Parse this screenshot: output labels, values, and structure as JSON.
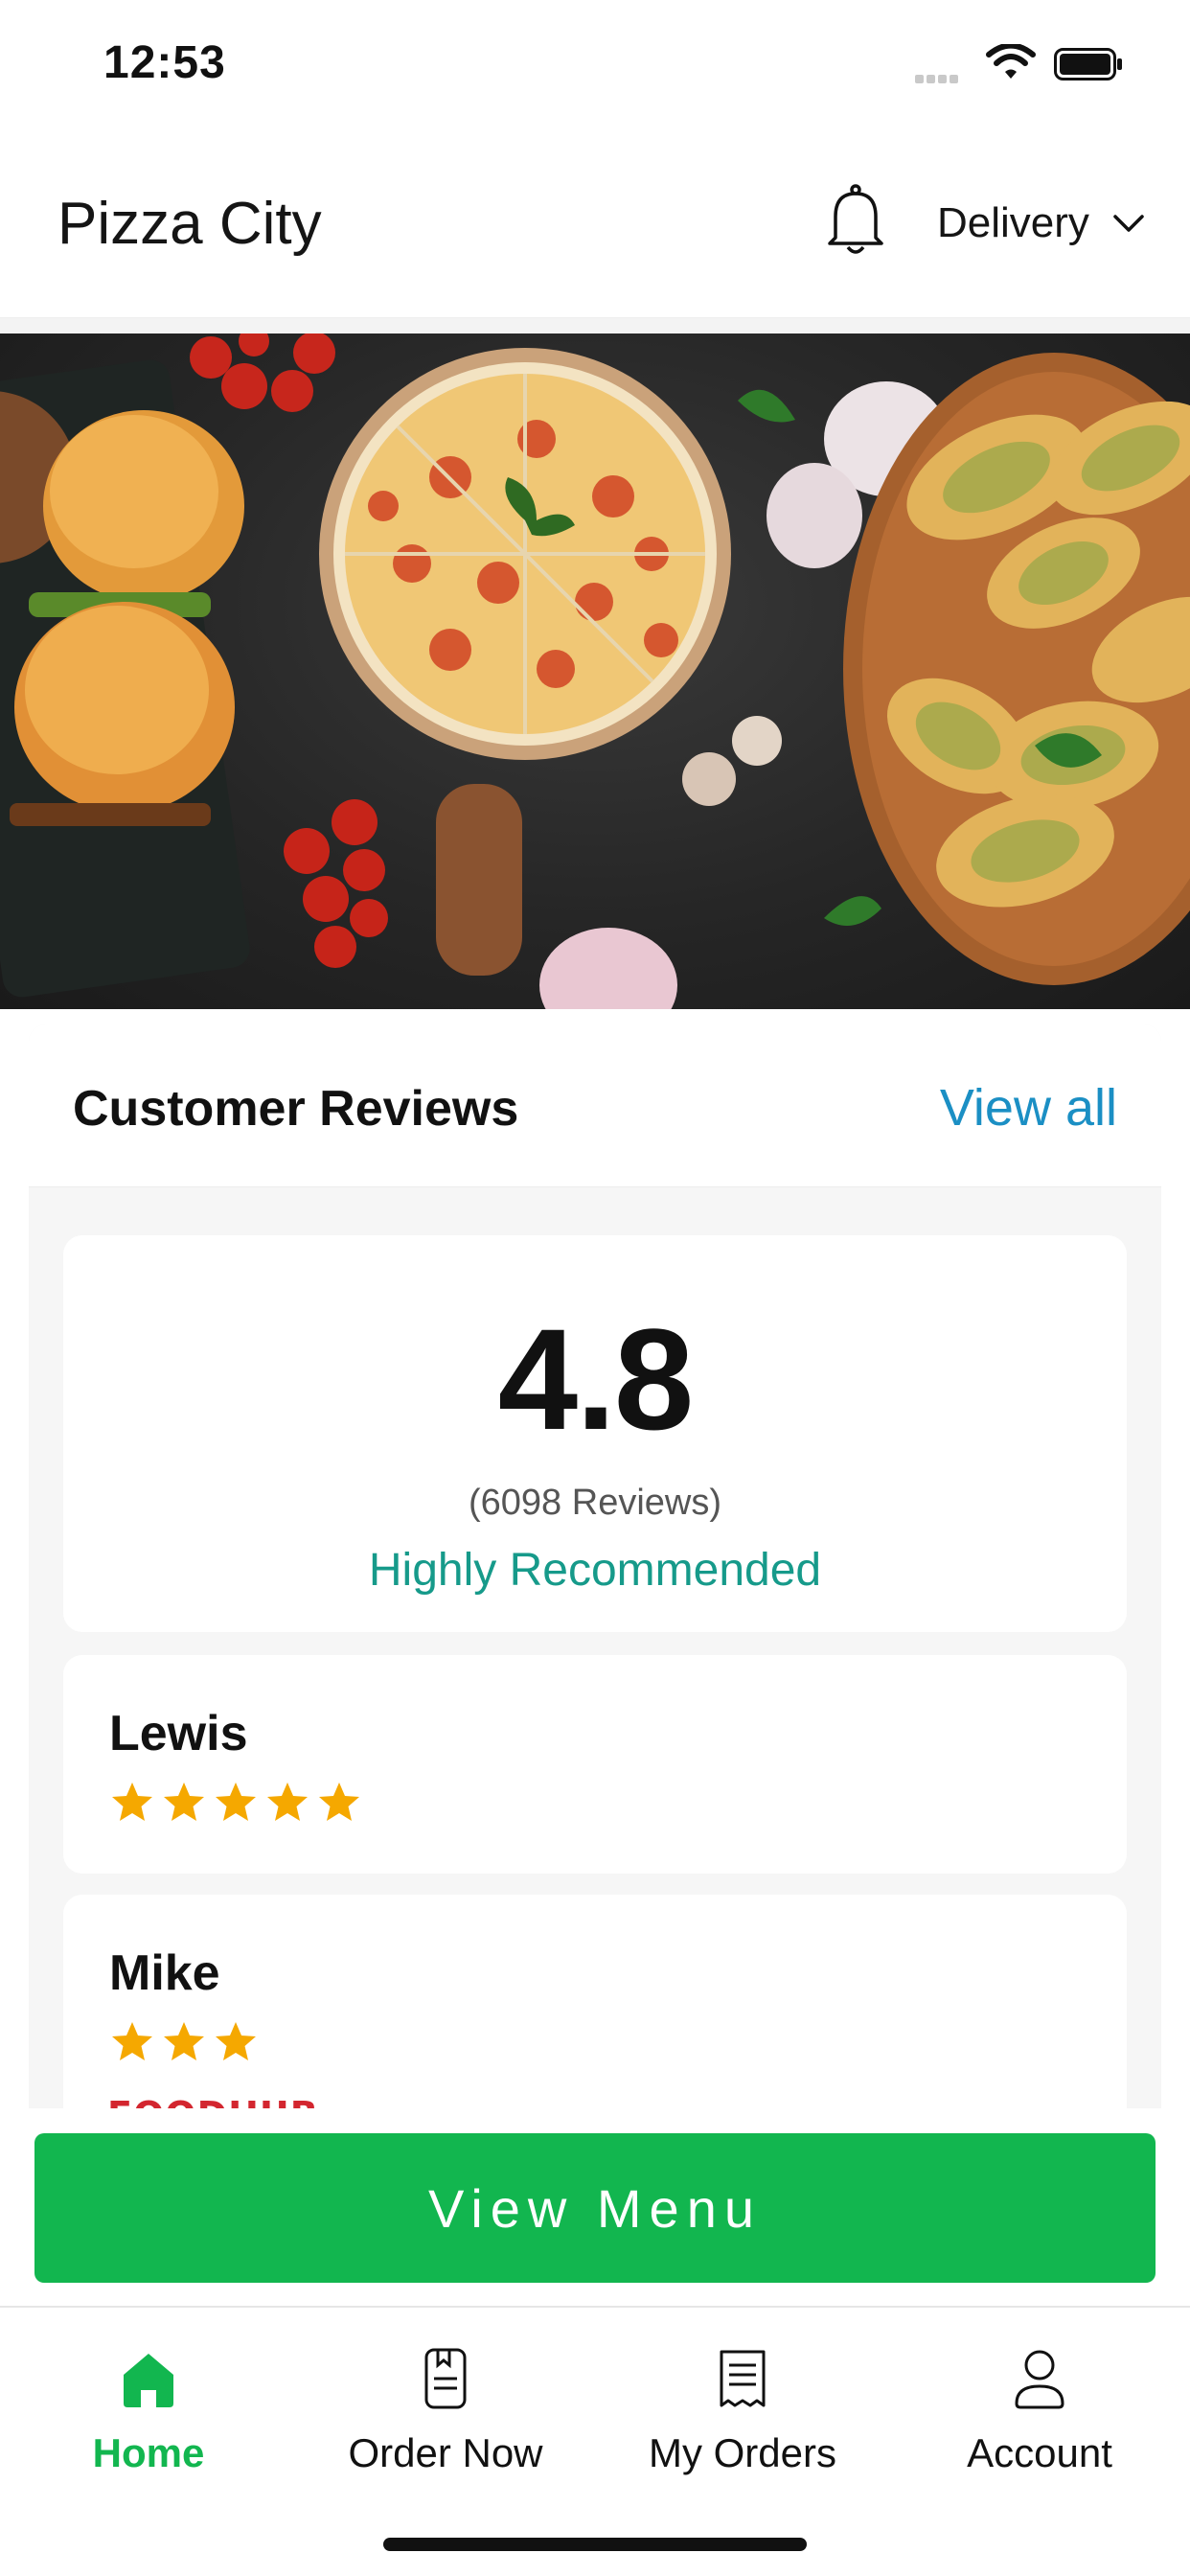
{
  "status_bar": {
    "time": "12:53"
  },
  "header": {
    "title": "Pizza City",
    "mode": "Delivery"
  },
  "reviews": {
    "title": "Customer Reviews",
    "view_all": "View all",
    "rating": "4.8",
    "count": "(6098 Reviews)",
    "label": "Highly Recommended",
    "items": [
      {
        "name": "Lewis",
        "stars": 5
      },
      {
        "name": "Mike",
        "stars": 3,
        "source": "FOODHUB"
      }
    ]
  },
  "cta": {
    "label": "View Menu"
  },
  "tabs": [
    {
      "label": "Home",
      "active": true
    },
    {
      "label": "Order Now",
      "active": false
    },
    {
      "label": "My Orders",
      "active": false
    },
    {
      "label": "Account",
      "active": false
    }
  ],
  "colors": {
    "accent_green": "#12b64f",
    "link_blue": "#1b8fc4",
    "teal": "#169a8a",
    "star": "#f5a800"
  }
}
